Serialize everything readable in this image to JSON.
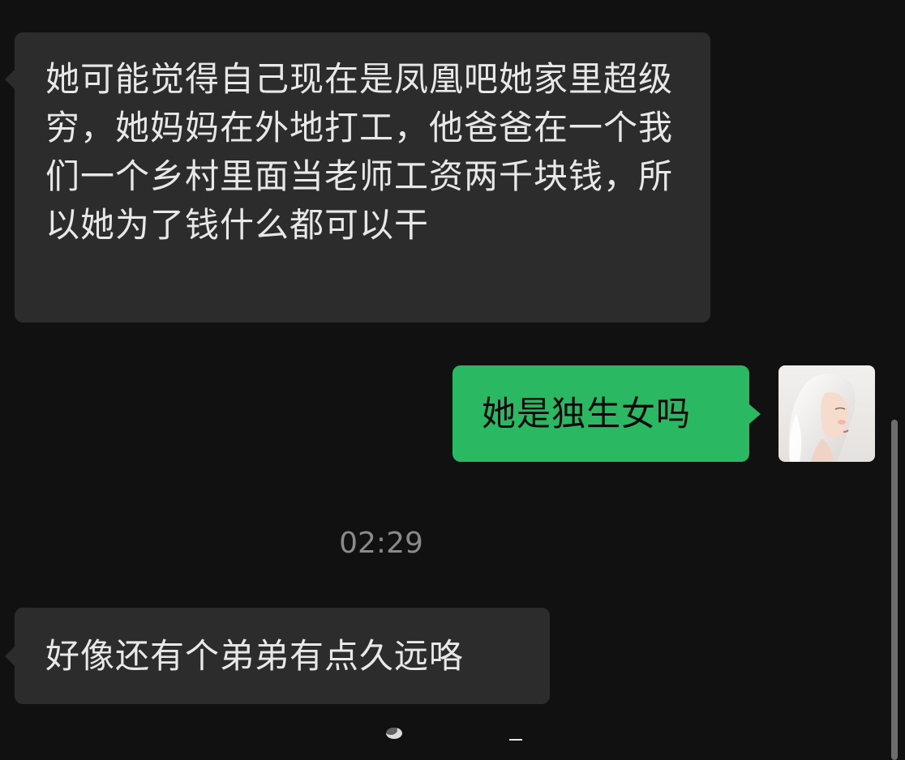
{
  "messages": [
    {
      "direction": "incoming",
      "text": "她可能觉得自己现在是凤凰吧她家里超级穷，她妈妈在外地打工，他爸爸在一个我们一个乡村里面当老师工资两千块钱，所以她为了钱什么都可以干"
    },
    {
      "direction": "outgoing",
      "text": "她是独生女吗",
      "avatar": "user-avatar-anime-girl"
    },
    {
      "direction": "incoming",
      "text": "好像还有个弟弟有点久远咯"
    }
  ],
  "timestamp": "02:29",
  "colors": {
    "background": "#111111",
    "incoming_bubble": "#2c2c2c",
    "outgoing_bubble": "#2ab962",
    "timestamp_text": "#8a8a8a"
  }
}
